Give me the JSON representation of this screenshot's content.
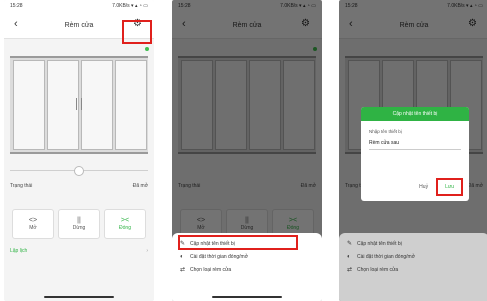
{
  "status": {
    "time": "15:28",
    "right": "7.0KB/s ▾ ▴ ◔ ▭"
  },
  "appbar": {
    "title": "Rèm cửa",
    "back_glyph": "‹",
    "gear_glyph": "⚙"
  },
  "state": {
    "label": "Trạng thái",
    "value": "Đã mở"
  },
  "controls": {
    "open": {
      "icon": "<>",
      "label": "Mở"
    },
    "stop": {
      "icon": "||",
      "label": "Dừng"
    },
    "close": {
      "icon": "><",
      "label": "Đóng"
    }
  },
  "schedule": {
    "label": "Lập lịch",
    "chevron": "›"
  },
  "sheet": {
    "items": [
      {
        "label": "Cập nhật tên thiết bị",
        "icon": "✎"
      },
      {
        "label": "Cài đặt thời gian đóng/mở",
        "icon": "◐"
      },
      {
        "label": "Chọn loại rèm cửa",
        "icon": "⇄"
      }
    ]
  },
  "dialog": {
    "title": "Cập nhật tên thiết bị",
    "field_label": "Nhập tên thiết bị",
    "field_value": "Rèm cửa sau",
    "cancel": "Huỷ",
    "save": "Lưu"
  },
  "colors": {
    "accent": "#2fb344",
    "highlight": "#e0201c"
  }
}
